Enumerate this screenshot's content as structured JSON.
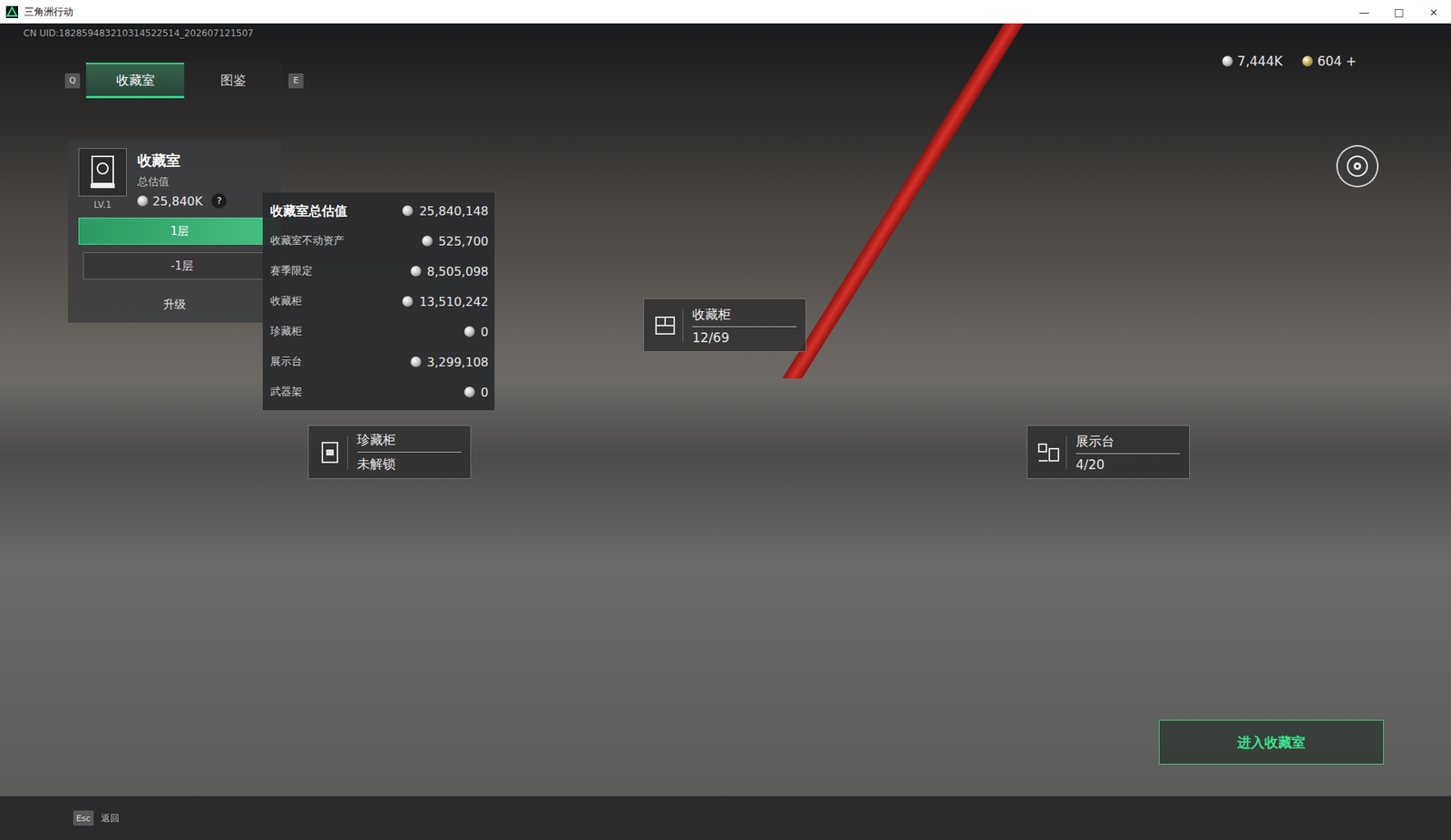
{
  "window": {
    "title": "三角洲行动",
    "controls": [
      "—",
      "□",
      "×"
    ]
  },
  "uid": "CN UID:182859483210314522514_202607121507",
  "tabs": {
    "prev_key": "Q",
    "next_key": "E",
    "items": [
      {
        "label": "收藏室",
        "selected": true
      },
      {
        "label": "图鉴",
        "selected": false
      }
    ]
  },
  "currencies": [
    {
      "amount": "7,444K",
      "color": "#c9c9c9"
    },
    {
      "amount": "604 +",
      "color": "#c9a94a"
    }
  ],
  "room_card": {
    "title": "收藏室",
    "subtitle": "总估值",
    "level": "LV.1",
    "value": "25,840K",
    "help": "?",
    "floors": [
      {
        "label": "1层",
        "selected": true
      },
      {
        "label": "-1层",
        "selected": false
      }
    ],
    "upgrade": "升级"
  },
  "valuation_tooltip": {
    "title": "收藏室总估值",
    "total": "25,840,148",
    "rows": [
      {
        "label": "收藏室不动资产",
        "value": "525,700"
      },
      {
        "label": "赛季限定",
        "value": "8,505,098"
      },
      {
        "label": "收藏柜",
        "value": "13,510,242"
      },
      {
        "label": "珍藏柜",
        "value": "0"
      },
      {
        "label": "展示台",
        "value": "3,299,108"
      },
      {
        "label": "武器架",
        "value": "0"
      }
    ]
  },
  "hotspots": [
    {
      "name": "收藏柜",
      "status": "12/69"
    },
    {
      "name": "珍藏柜",
      "status": "未解锁"
    },
    {
      "name": "展示台",
      "status": "4/20"
    }
  ],
  "enter_button": "进入收藏室",
  "footer": {
    "key": "Esc",
    "label": "返回"
  }
}
